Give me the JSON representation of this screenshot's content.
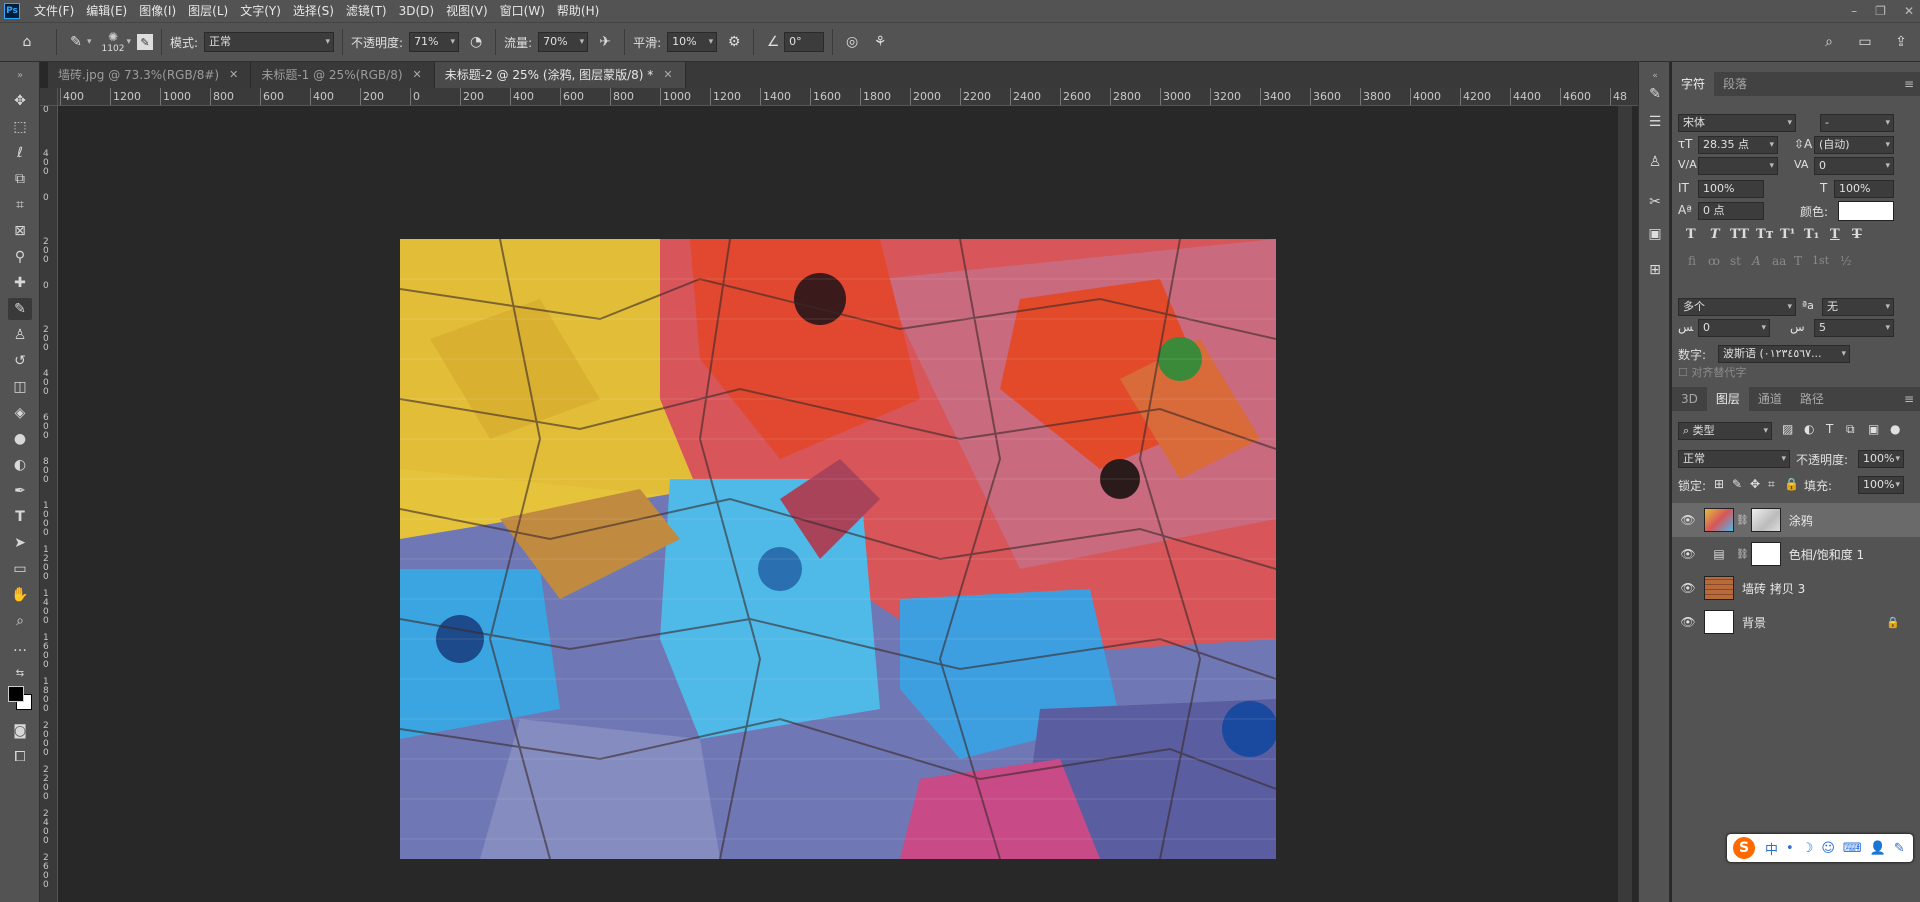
{
  "menubar": {
    "logo": "Ps",
    "items": [
      "文件(F)",
      "编辑(E)",
      "图像(I)",
      "图层(L)",
      "文字(Y)",
      "选择(S)",
      "滤镜(T)",
      "3D(D)",
      "视图(V)",
      "窗口(W)",
      "帮助(H)"
    ],
    "window_controls": [
      "–",
      "❐",
      "✕"
    ]
  },
  "optionsbar": {
    "brush_size": "1102",
    "mode_label": "模式:",
    "mode_value": "正常",
    "opacity_label": "不透明度:",
    "opacity_value": "71%",
    "flow_label": "流量:",
    "flow_value": "70%",
    "smooth_label": "平滑:",
    "smooth_value": "10%",
    "angle_value": "0°"
  },
  "tabs": [
    {
      "label": "墙砖.jpg @ 73.3%(RGB/8#)",
      "active": false
    },
    {
      "label": "未标题-1 @ 25%(RGB/8)",
      "active": false
    },
    {
      "label": "未标题-2 @ 25% (涂鸦, 图层蒙版/8) *",
      "active": true
    }
  ],
  "hruler_labels": [
    "400",
    "1200",
    "1000",
    "800",
    "600",
    "400",
    "200",
    "0",
    "200",
    "400",
    "600",
    "800",
    "1000",
    "1200",
    "1400",
    "1600",
    "1800",
    "2000",
    "2200",
    "2400",
    "2600",
    "2800",
    "3000",
    "3200",
    "3400",
    "3600",
    "3800",
    "4000",
    "4200",
    "4400",
    "4600",
    "48"
  ],
  "vruler_labels": [
    "0",
    "4 0 0",
    "0",
    "2 0 0",
    "0",
    "2 0 0",
    "4 0 0",
    "6 0 0",
    "8 0 0",
    "1 0 0 0",
    "1 2 0 0",
    "1 4 0 0",
    "1 6 0 0",
    "1 8 0 0",
    "2 0 0 0",
    "2 2 0 0",
    "2 4 0 0",
    "2 6 0 0"
  ],
  "character_panel": {
    "tabs": [
      "字符",
      "段落"
    ],
    "font_family": "宋体",
    "font_style": "-",
    "font_size": "28.35 点",
    "leading": "(自动)",
    "kerning": "",
    "tracking": "0",
    "vertical_scale": "100%",
    "horizontal_scale": "100%",
    "baseline_shift": "0 点",
    "color_label": "颜色:",
    "language": "多个",
    "antialias": "无",
    "field_a": "0",
    "field_b": "5",
    "digits_label": "数字:",
    "digits_value": "波斯语 (٠١٢٣٤٥٦٧...",
    "alt_glyphs": "对齐替代字",
    "typo_row1": [
      "T",
      "T",
      "TT",
      "Tт",
      "T¹",
      "T₁",
      "T",
      "T"
    ],
    "typo_row2": [
      "fi",
      "ꝏ",
      "st",
      "A",
      "aa",
      "T",
      "1st",
      "½"
    ]
  },
  "layers_panel": {
    "tabs": [
      "3D",
      "图层",
      "通道",
      "路径"
    ],
    "filter_label": "类型",
    "blend_mode": "正常",
    "opacity_label": "不透明度:",
    "opacity_value": "100%",
    "lock_label": "锁定:",
    "fill_label": "填充:",
    "fill_value": "100%",
    "layers": [
      {
        "name": "涂鸦",
        "selected": true
      },
      {
        "name": "色相/饱和度 1",
        "selected": false
      },
      {
        "name": "墙砖 拷贝 3",
        "selected": false
      },
      {
        "name": "背景",
        "selected": false
      }
    ]
  },
  "ime": {
    "logo": "S",
    "items": [
      "中",
      "•",
      "☽",
      "☺",
      "⌨",
      "👤",
      "✎"
    ]
  },
  "colors": {
    "ui_bg": "#535353",
    "canvas_bg": "#282828",
    "active_tab": "#4a4a4a",
    "selected_layer": "#6a6a6a",
    "ime_accent": "#ff6a00"
  }
}
